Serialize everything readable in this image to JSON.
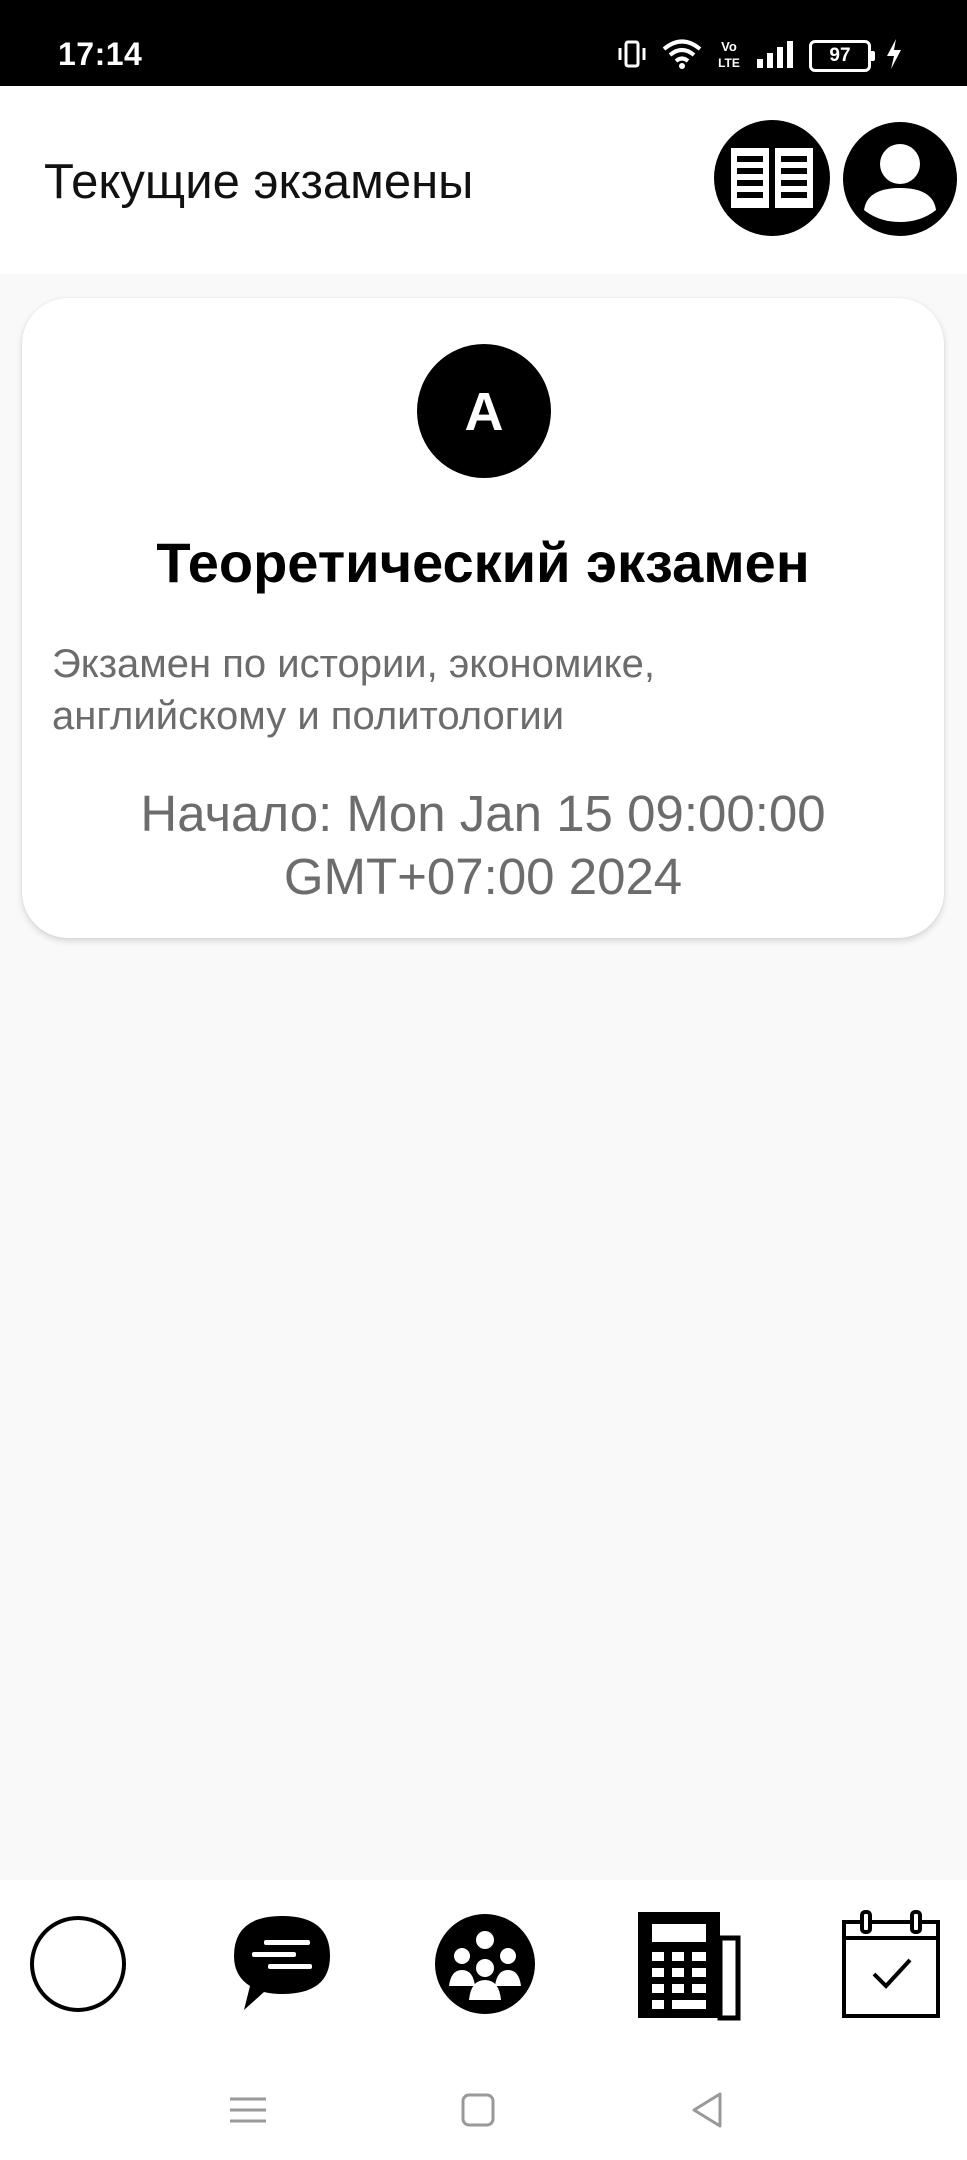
{
  "status_bar": {
    "time": "17:14",
    "battery_level": "97",
    "network_label": "Vo LTE",
    "icons": [
      "vibrate-icon",
      "wifi-icon",
      "volte-icon",
      "signal-icon",
      "battery-icon",
      "charging-icon"
    ]
  },
  "header": {
    "title": "Текущие экзамены",
    "actions": [
      {
        "icon": "books-icon"
      },
      {
        "icon": "profile-icon"
      }
    ]
  },
  "exam_card": {
    "avatar_letter": "A",
    "title": "Теоретический экзамен",
    "description": "Экзамен по истории, экономике, английскому и политологии",
    "start_text": "Начало: Mon Jan 15 09:00:00 GMT+07:00 2024"
  },
  "bottom_nav": {
    "items": [
      {
        "icon": "empty-circle-icon"
      },
      {
        "icon": "chat-bubble-icon"
      },
      {
        "icon": "group-icon"
      },
      {
        "icon": "calculator-icon"
      },
      {
        "icon": "calendar-check-icon"
      }
    ]
  },
  "system_nav": {
    "items": [
      {
        "icon": "menu-icon"
      },
      {
        "icon": "home-icon"
      },
      {
        "icon": "back-icon"
      }
    ]
  },
  "colors": {
    "background": "#f9f9f9",
    "card": "#ffffff",
    "text_primary": "#000000",
    "text_secondary": "#6c6c6c",
    "status_bar": "#000000"
  }
}
